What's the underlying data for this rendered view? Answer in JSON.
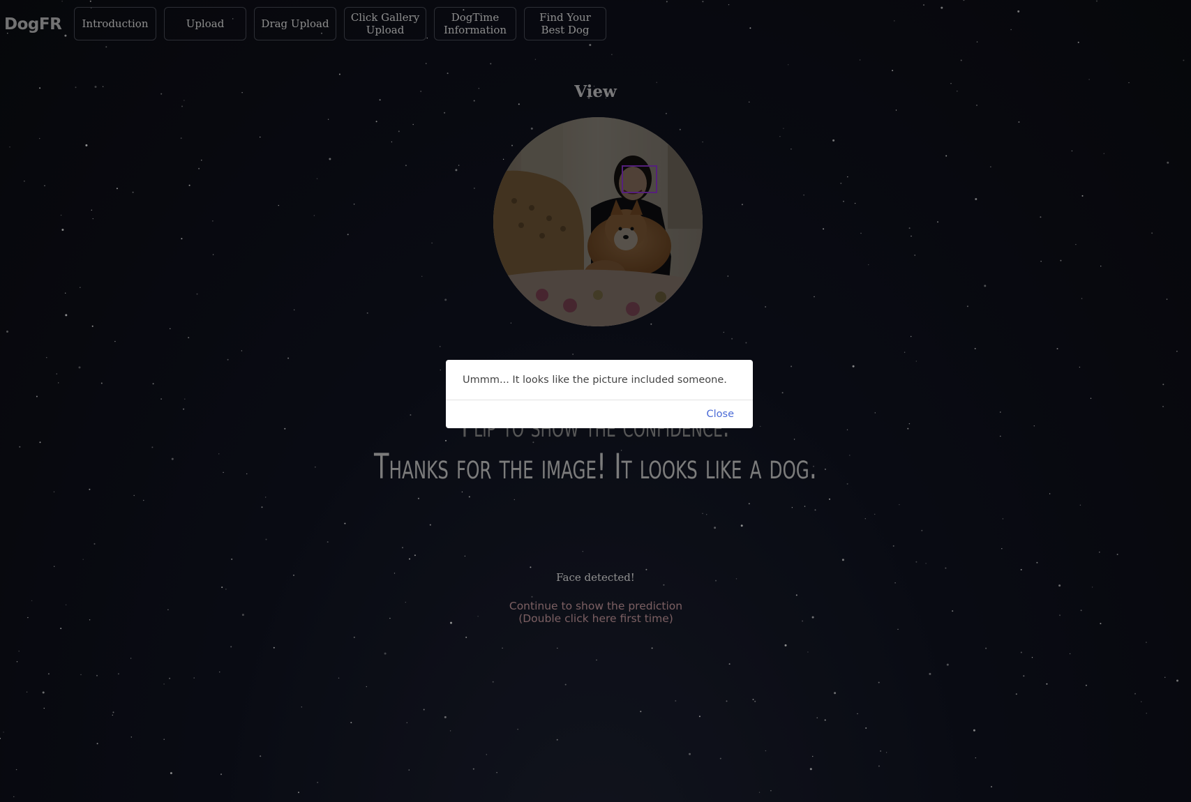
{
  "app": {
    "logo": "DogFR"
  },
  "nav": {
    "items": [
      {
        "label": "Introduction"
      },
      {
        "label": "Upload"
      },
      {
        "label": "Drag Upload"
      },
      {
        "label": "Click Gallery Upload"
      },
      {
        "label": "DogTime Information"
      },
      {
        "label": "Find Your Best Dog"
      }
    ]
  },
  "main": {
    "view_title": "View",
    "confidence_text": "Flip to show the confidence.",
    "result_text": "Thanks for the image! It looks like a dog.",
    "face_status": "Face detected!",
    "continue_link": "Continue to show the prediction (Double click here first time)"
  },
  "modal": {
    "message": "Ummm... It looks like the picture included someone.",
    "close_label": "Close"
  },
  "colors": {
    "background": "#0b0c12",
    "face_box": "#8a35c8",
    "link": "#c79a9e",
    "close": "#4a6ad6"
  }
}
